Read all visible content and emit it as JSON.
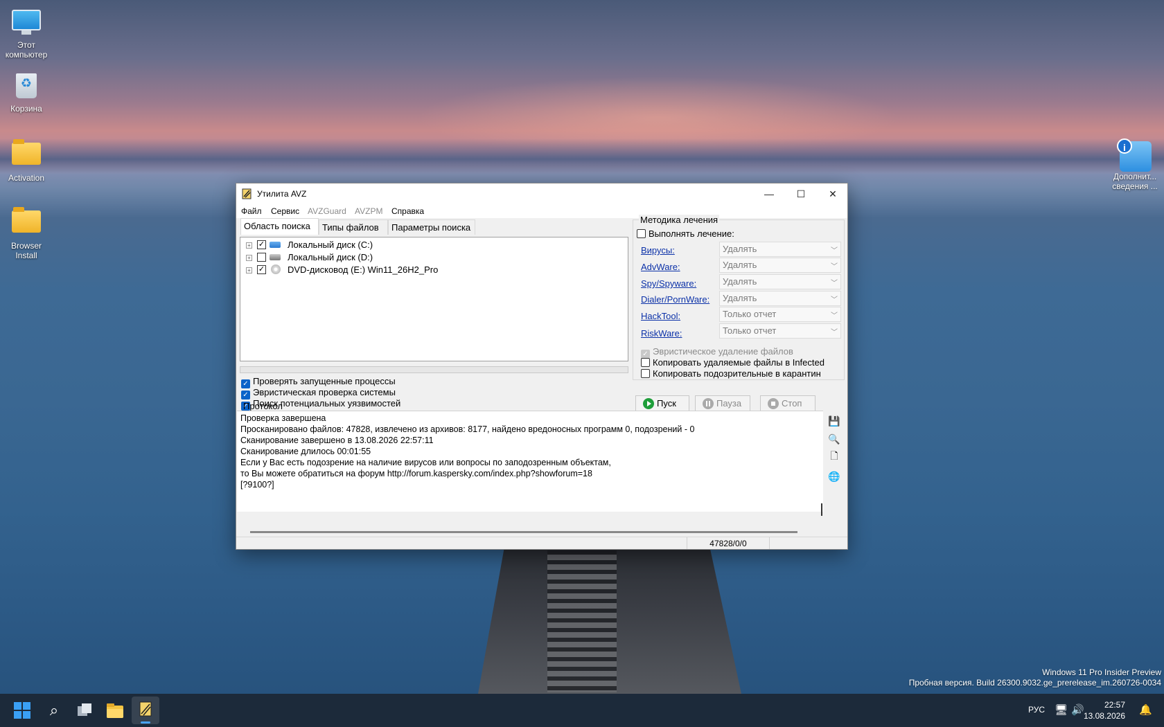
{
  "desktop": {
    "icons": [
      {
        "label": "Этот компьютер",
        "icon": "computer-icon"
      },
      {
        "label": "Корзина",
        "icon": "recycle-bin-icon"
      },
      {
        "label": "Activation",
        "icon": "folder-icon"
      },
      {
        "label": "Browser Install",
        "icon": "folder-icon"
      },
      {
        "label": "Дополнит... сведения ...",
        "icon": "info-photo-icon"
      }
    ],
    "watermark": [
      "Windows 11 Pro Insider Preview",
      "Пробная версия. Build 26300.9032.ge_prerelease_im.260726-0034"
    ]
  },
  "window": {
    "title": "Утилита AVZ",
    "controls": {
      "minimize": "—",
      "maximize": "☐",
      "close": "✕"
    },
    "menu": [
      {
        "label": "Файл",
        "enabled": true
      },
      {
        "label": "Сервис",
        "enabled": true
      },
      {
        "label": "AVZGuard",
        "enabled": false
      },
      {
        "label": "AVZPM",
        "enabled": false
      },
      {
        "label": "Справка",
        "enabled": true
      }
    ],
    "tabs": [
      "Область поиска",
      "Типы файлов",
      "Параметры поиска"
    ],
    "active_tab": "Область поиска",
    "drives": [
      {
        "label": "Локальный диск (C:)",
        "checked": true
      },
      {
        "label": "Локальный диск (D:)",
        "checked": false
      },
      {
        "label": "DVD-дисковод (E:) Win11_26H2_Pro",
        "checked": true
      }
    ],
    "scan_options": [
      {
        "label": "Проверять запущенные процессы",
        "checked": true
      },
      {
        "label": "Эвристическая проверка системы",
        "checked": true
      },
      {
        "label": "Поиск потенциальных уязвимостей",
        "checked": true
      }
    ],
    "treatment": {
      "title": "Методика лечения",
      "perform_label": "Выполнять лечение:",
      "rows": [
        {
          "label": "Вирусы:",
          "value": "Удалять"
        },
        {
          "label": "AdvWare:",
          "value": "Удалять"
        },
        {
          "label": "Spy/Spyware:",
          "value": "Удалять"
        },
        {
          "label": "Dialer/PornWare:",
          "value": "Удалять"
        },
        {
          "label": "HackTool:",
          "value": "Только отчет"
        },
        {
          "label": "RiskWare:",
          "value": "Только отчет"
        }
      ],
      "options": [
        {
          "label": "Эвристическое удаление файлов",
          "checked": true,
          "enabled": false
        },
        {
          "label": "Копировать удаляемые файлы в  Infected",
          "checked": false,
          "enabled": true
        },
        {
          "label": "Копировать подозрительные в  карантин",
          "checked": false,
          "enabled": true
        }
      ]
    },
    "buttons": {
      "start": "Пуск",
      "pause": "Пауза",
      "stop": "Стоп"
    },
    "protocol_label": "Протокол",
    "log": [
      "Проверка завершена",
      "Просканировано файлов: 47828, извлечено из архивов: 8177, найдено вредоносных программ 0, подозрений - 0",
      "Сканирование завершено в 13.08.2026 22:57:11",
      "Сканирование длилось 00:01:55",
      "Если у Вас есть подозрение на наличие вирусов или вопросы по заподозренным объектам,",
      "то Вы можете обратиться на форум http://forum.kaspersky.com/index.php?showforum=18",
      "[?9100?]"
    ],
    "status": "47828/0/0"
  },
  "taskbar": {
    "language": "РУС",
    "time": "22:57",
    "date": "13.08.2026"
  }
}
